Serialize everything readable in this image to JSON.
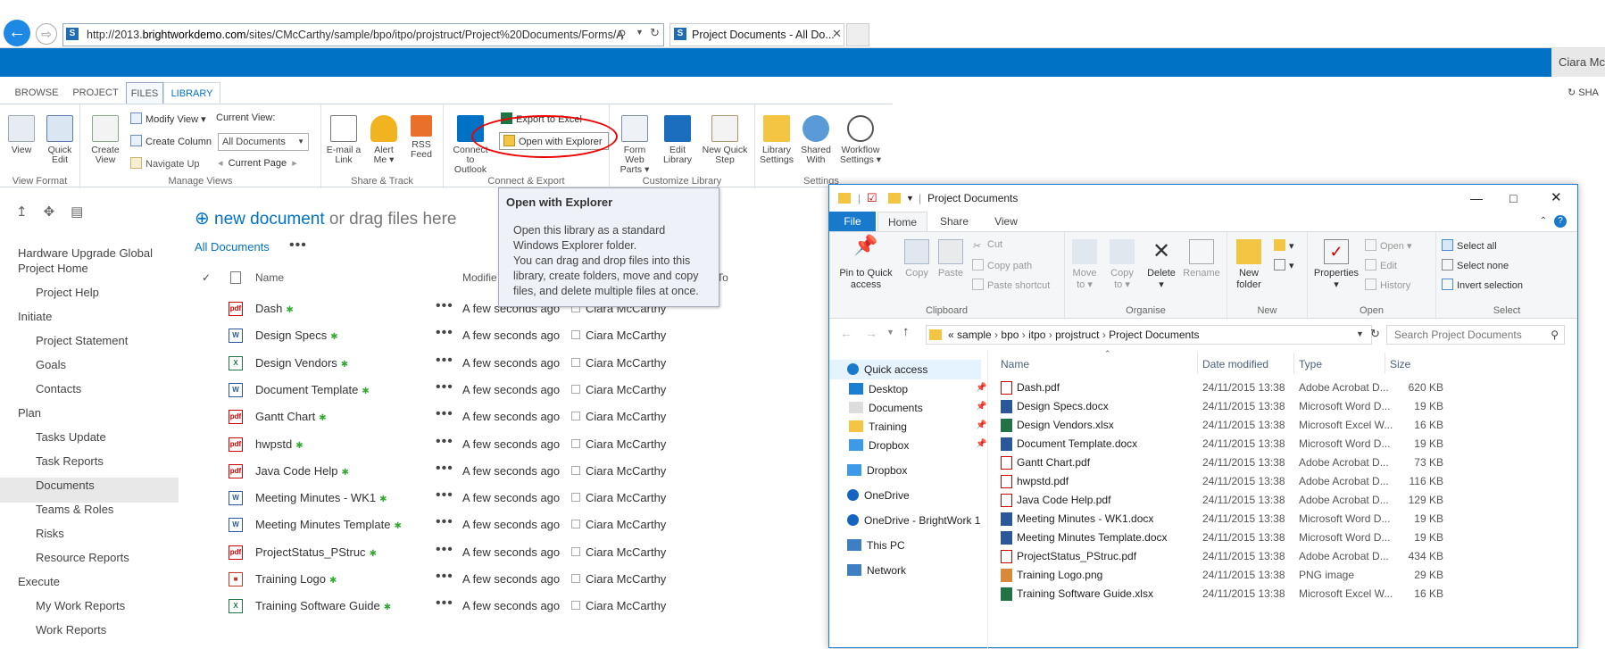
{
  "browser": {
    "url_prefix": "http://2013.",
    "url_host": "brightworkdemo.com",
    "url_rest": "/sites/CMcCarthy/sample/bpo/itpo/projstruct/Project%20Documents/Forms/A",
    "tab_title": "Project Documents - All Do..."
  },
  "suite": {
    "user_name": "Ciara McC",
    "share_label": "SHA"
  },
  "ribbon": {
    "tabs": [
      "BROWSE",
      "PROJECT",
      "FILES",
      "LIBRARY"
    ],
    "groups": {
      "view_format": "View Format",
      "manage_views": "Manage Views",
      "share_track": "Share & Track",
      "connect_export": "Connect & Export",
      "customize_library": "Customize Library",
      "settings": "Settings"
    },
    "buttons": {
      "view": "View",
      "quick_edit_1": "Quick",
      "quick_edit_2": "Edit",
      "create_view_1": "Create",
      "create_view_2": "View",
      "modify_view": "Modify View",
      "create_column": "Create Column",
      "navigate_up": "Navigate Up",
      "current_view_label": "Current View:",
      "current_view_value": "All Documents",
      "current_page": "Current Page",
      "email_link_1": "E-mail a",
      "email_link_2": "Link",
      "alert_me_1": "Alert",
      "alert_me_2": "Me",
      "rss_1": "RSS",
      "rss_2": "Feed",
      "connect_outlook_1": "Connect to",
      "connect_outlook_2": "Outlook",
      "export_excel": "Export to Excel",
      "open_explorer": "Open with Explorer",
      "form_web_parts_1": "Form Web",
      "form_web_parts_2": "Parts",
      "edit_library_1": "Edit",
      "edit_library_2": "Library",
      "new_quick_step_1": "New Quick",
      "new_quick_step_2": "Step",
      "library_settings_1": "Library",
      "library_settings_2": "Settings",
      "shared_with_1": "Shared",
      "shared_with_2": "With",
      "workflow_settings_1": "Workflow",
      "workflow_settings_2": "Settings"
    }
  },
  "tooltip": {
    "title": "Open with Explorer",
    "p1": "Open this library as a standard Windows Explorer folder.",
    "p2": "You can drag and drop files into this library, create folders, move and copy files, and delete multiple files at once."
  },
  "nav": {
    "items": [
      {
        "label": "Hardware Upgrade Global",
        "indent": 0
      },
      {
        "label": "Project Home",
        "indent": 0
      },
      {
        "label": "Project Help",
        "indent": 1
      },
      {
        "label": "Initiate",
        "indent": 0
      },
      {
        "label": "Project Statement",
        "indent": 1
      },
      {
        "label": "Goals",
        "indent": 1
      },
      {
        "label": "Contacts",
        "indent": 1
      },
      {
        "label": "Plan",
        "indent": 0
      },
      {
        "label": "Tasks Update",
        "indent": 1
      },
      {
        "label": "Task Reports",
        "indent": 1
      },
      {
        "label": "Documents",
        "indent": 1
      },
      {
        "label": "Teams & Roles",
        "indent": 1
      },
      {
        "label": "Risks",
        "indent": 1
      },
      {
        "label": "Resource Reports",
        "indent": 1
      },
      {
        "label": "Execute",
        "indent": 0
      },
      {
        "label": "My Work Reports",
        "indent": 1
      },
      {
        "label": "Work Reports",
        "indent": 1
      }
    ]
  },
  "main": {
    "new_document": "new document",
    "or_drag": " or drag files here",
    "view_name": "All Documents",
    "more": "•••",
    "col_name": "Name",
    "col_modified": "Modifie",
    "col_checked_out": "ut To",
    "rows": [
      {
        "name": "Dash",
        "type": "pdf",
        "modified": "A few seconds ago",
        "by": "Ciara McCarthy"
      },
      {
        "name": "Design Specs",
        "type": "doc",
        "modified": "A few seconds ago",
        "by": "Ciara McCarthy"
      },
      {
        "name": "Design Vendors",
        "type": "xls",
        "modified": "A few seconds ago",
        "by": "Ciara McCarthy"
      },
      {
        "name": "Document Template",
        "type": "doc",
        "modified": "A few seconds ago",
        "by": "Ciara McCarthy"
      },
      {
        "name": "Gantt Chart",
        "type": "pdf",
        "modified": "A few seconds ago",
        "by": "Ciara McCarthy"
      },
      {
        "name": "hwpstd",
        "type": "pdf",
        "modified": "A few seconds ago",
        "by": "Ciara McCarthy"
      },
      {
        "name": "Java Code Help",
        "type": "pdf",
        "modified": "A few seconds ago",
        "by": "Ciara McCarthy"
      },
      {
        "name": "Meeting Minutes - WK1",
        "type": "doc",
        "modified": "A few seconds ago",
        "by": "Ciara McCarthy"
      },
      {
        "name": "Meeting Minutes Template",
        "type": "doc",
        "modified": "A few seconds ago",
        "by": "Ciara McCarthy"
      },
      {
        "name": "ProjectStatus_PStruc",
        "type": "pdf",
        "modified": "A few seconds ago",
        "by": "Ciara McCarthy"
      },
      {
        "name": "Training Logo",
        "type": "png",
        "modified": "A few seconds ago",
        "by": "Ciara McCarthy"
      },
      {
        "name": "Training Software Guide",
        "type": "xls",
        "modified": "A few seconds ago",
        "by": "Ciara McCarthy"
      }
    ]
  },
  "explorer": {
    "title": "Project Documents",
    "menu": [
      "File",
      "Home",
      "Share",
      "View"
    ],
    "clipboard": {
      "pin_1": "Pin to Quick",
      "pin_2": "access",
      "copy": "Copy",
      "paste": "Paste",
      "cut": "Cut",
      "copy_path": "Copy path",
      "paste_shortcut": "Paste shortcut",
      "label": "Clipboard"
    },
    "organise": {
      "move_1": "Move",
      "move_2": "to",
      "copy_1": "Copy",
      "copy_2": "to",
      "delete": "Delete",
      "rename": "Rename",
      "label": "Organise"
    },
    "new": {
      "folder_1": "New",
      "folder_2": "folder",
      "label": "New"
    },
    "open": {
      "properties": "Properties",
      "open": "Open",
      "edit": "Edit",
      "history": "History",
      "label": "Open"
    },
    "select": {
      "all": "Select all",
      "none": "Select none",
      "invert": "Invert selection",
      "label": "Select"
    },
    "path": [
      "«",
      "sample",
      "bpo",
      "itpo",
      "projstruct",
      "Project Documents"
    ],
    "search_placeholder": "Search Project Documents",
    "tree": [
      {
        "label": "Quick access",
        "level": 0,
        "icon": "star"
      },
      {
        "label": "Desktop",
        "level": 1,
        "icon": "desktop",
        "pin": true
      },
      {
        "label": "Documents",
        "level": 1,
        "icon": "docs",
        "pin": true
      },
      {
        "label": "Training",
        "level": 1,
        "icon": "folder",
        "pin": true
      },
      {
        "label": "Dropbox",
        "level": 1,
        "icon": "dropbox",
        "pin": true
      },
      {
        "label": "Dropbox",
        "level": 0,
        "icon": "dropbox"
      },
      {
        "label": "OneDrive",
        "level": 0,
        "icon": "cloud"
      },
      {
        "label": "OneDrive - BrightWork 1",
        "level": 0,
        "icon": "cloud"
      },
      {
        "label": "This PC",
        "level": 0,
        "icon": "pc"
      },
      {
        "label": "Network",
        "level": 0,
        "icon": "network"
      }
    ],
    "columns": [
      "Name",
      "Date modified",
      "Type",
      "Size"
    ],
    "files": [
      {
        "name": "Dash.pdf",
        "type_icon": "pdf",
        "date": "24/11/2015 13:38",
        "type": "Adobe Acrobat D...",
        "size": "620 KB"
      },
      {
        "name": "Design Specs.docx",
        "type_icon": "doc",
        "date": "24/11/2015 13:38",
        "type": "Microsoft Word D...",
        "size": "19 KB"
      },
      {
        "name": "Design Vendors.xlsx",
        "type_icon": "xls",
        "date": "24/11/2015 13:38",
        "type": "Microsoft Excel W...",
        "size": "16 KB"
      },
      {
        "name": "Document Template.docx",
        "type_icon": "doc",
        "date": "24/11/2015 13:38",
        "type": "Microsoft Word D...",
        "size": "19 KB"
      },
      {
        "name": "Gantt Chart.pdf",
        "type_icon": "pdf",
        "date": "24/11/2015 13:38",
        "type": "Adobe Acrobat D...",
        "size": "73 KB"
      },
      {
        "name": "hwpstd.pdf",
        "type_icon": "pdf",
        "date": "24/11/2015 13:38",
        "type": "Adobe Acrobat D...",
        "size": "116 KB"
      },
      {
        "name": "Java Code Help.pdf",
        "type_icon": "pdf",
        "date": "24/11/2015 13:38",
        "type": "Adobe Acrobat D...",
        "size": "129 KB"
      },
      {
        "name": "Meeting Minutes - WK1.docx",
        "type_icon": "doc",
        "date": "24/11/2015 13:38",
        "type": "Microsoft Word D...",
        "size": "19 KB"
      },
      {
        "name": "Meeting Minutes Template.docx",
        "type_icon": "doc",
        "date": "24/11/2015 13:38",
        "type": "Microsoft Word D...",
        "size": "19 KB"
      },
      {
        "name": "ProjectStatus_PStruc.pdf",
        "type_icon": "pdf",
        "date": "24/11/2015 13:38",
        "type": "Adobe Acrobat D...",
        "size": "434 KB"
      },
      {
        "name": "Training Logo.png",
        "type_icon": "png",
        "date": "24/11/2015 13:38",
        "type": "PNG image",
        "size": "29 KB"
      },
      {
        "name": "Training Software Guide.xlsx",
        "type_icon": "xls",
        "date": "24/11/2015 13:38",
        "type": "Microsoft Excel W...",
        "size": "16 KB"
      }
    ]
  },
  "colors": {
    "accent": "#0072c6",
    "explorer_file_tab": "#1979ca",
    "annotation": "#e00000"
  }
}
